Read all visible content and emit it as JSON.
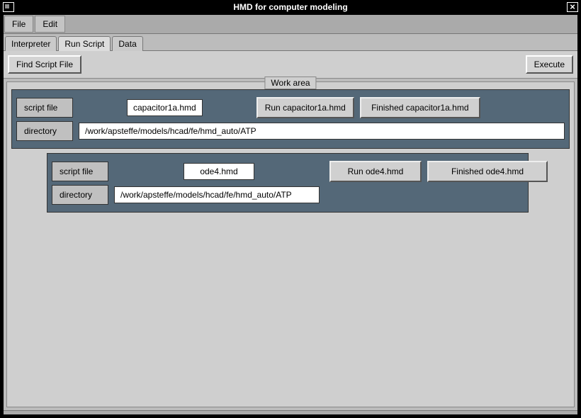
{
  "window": {
    "title": "HMD for computer modeling",
    "close": "×"
  },
  "menu": {
    "file": "File",
    "edit": "Edit"
  },
  "tabs": [
    {
      "label": "Interpreter"
    },
    {
      "label": "Run Script"
    },
    {
      "label": "Data"
    }
  ],
  "toolbar": {
    "find": "Find Script File",
    "execute": "Execute"
  },
  "work_area_label": "Work area",
  "labels": {
    "script_file": "script file",
    "directory": "directory"
  },
  "cards": [
    {
      "script": "capacitor1a.hmd",
      "run": "Run capacitor1a.hmd",
      "status": "Finished  capacitor1a.hmd",
      "directory": "/work/apsteffe/models/hcad/fe/hmd_auto/ATP"
    },
    {
      "script": "ode4.hmd",
      "run": "Run ode4.hmd",
      "status": "Finished  ode4.hmd",
      "directory": "/work/apsteffe/models/hcad/fe/hmd_auto/ATP"
    }
  ]
}
